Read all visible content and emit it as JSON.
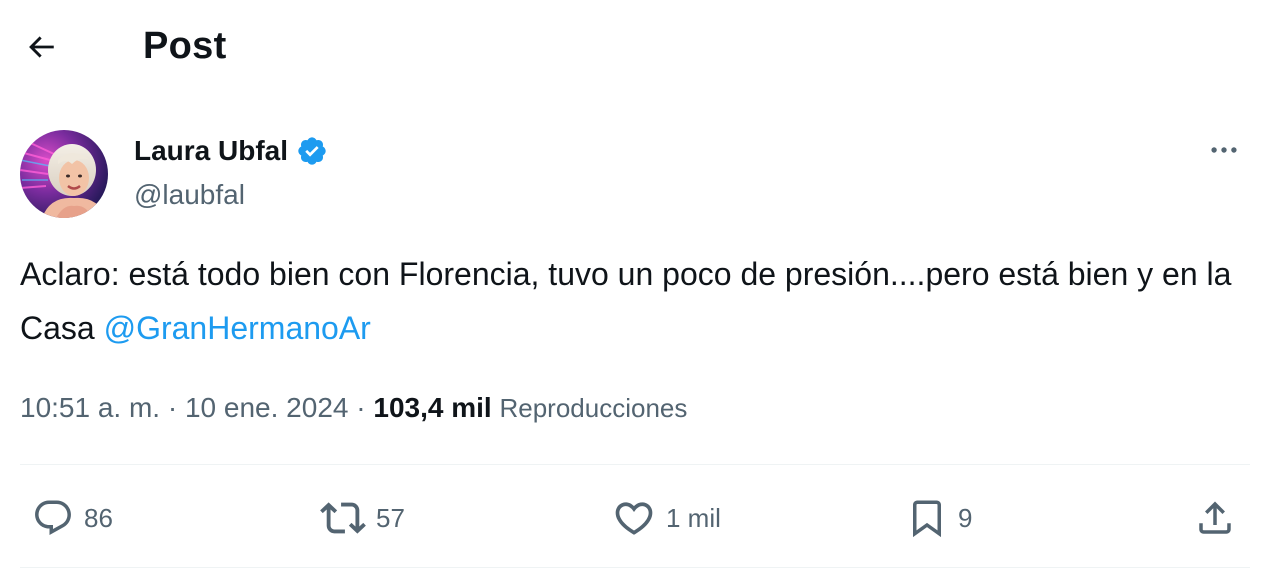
{
  "header": {
    "title": "Post",
    "back_icon": "arrow-left-icon"
  },
  "author": {
    "name": "Laura Ubfal",
    "handle": "@laubfal",
    "verified": true,
    "verified_color": "#1d9bf0"
  },
  "post": {
    "text_before_mention": "Aclaro: está todo bien con Florencia, tuvo un poco de presión....pero está bien y en la Casa ",
    "mention": "@GranHermanoAr",
    "time": "10:51 a. m.",
    "separator": "·",
    "date": "10 ene. 2024",
    "views_count": "103,4 mil",
    "views_label": "Reproducciones"
  },
  "actions": {
    "replies": "86",
    "reposts": "57",
    "likes": "1 mil",
    "bookmarks": "9"
  },
  "colors": {
    "text": "#0f1419",
    "secondary": "#536471",
    "accent": "#1d9bf0",
    "divider": "#eff3f4"
  }
}
